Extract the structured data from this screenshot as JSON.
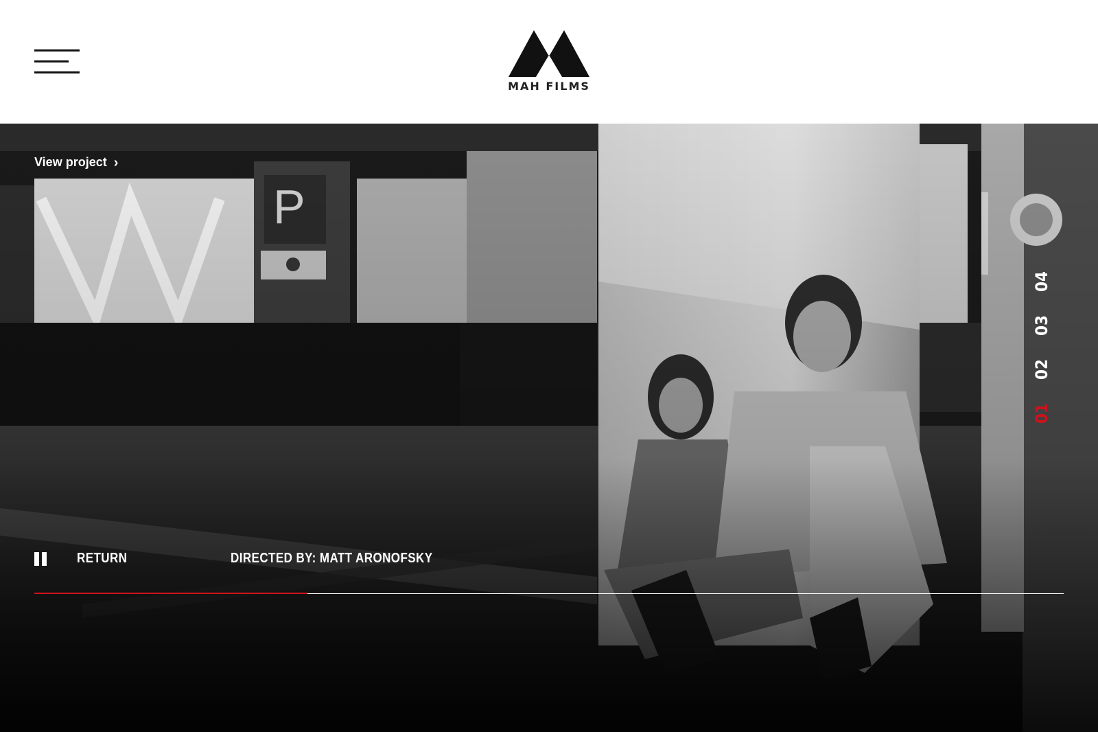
{
  "header": {
    "menu_icon": "hamburger-menu-icon",
    "logo_icon": "mountain-m-logo-icon",
    "logo_text": "MAH FILMS"
  },
  "hero": {
    "view_project_label": "View project",
    "view_project_icon": "chevron-right-icon",
    "slides": [
      "04",
      "03",
      "02",
      "01"
    ],
    "active_slide": "01",
    "accent_color": "#d0111b",
    "pause_icon": "pause-icon",
    "return_label": "RETURN",
    "credit": "DIRECTED BY: MATT ARONOFSKY",
    "progress_fraction": 0.265
  }
}
